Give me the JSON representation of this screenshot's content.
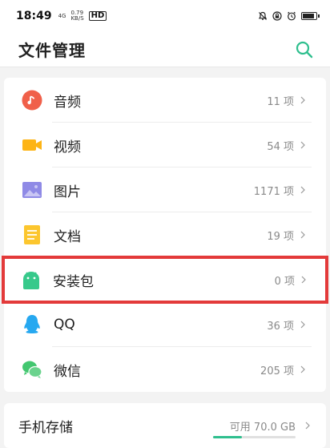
{
  "status_bar": {
    "time": "18:49",
    "signal": "4G",
    "speed_value": "0.79",
    "speed_unit": "KB/S",
    "hd": "HD",
    "battery_level": 0.9
  },
  "header": {
    "title": "文件管理",
    "search_icon": "search-icon",
    "accent": "#2fbf8e"
  },
  "categories": [
    {
      "label": "音频",
      "count": "11 项",
      "icon": "music-icon",
      "color": "#f0604a"
    },
    {
      "label": "视频",
      "count": "54 项",
      "icon": "video-icon",
      "color": "#fdb415"
    },
    {
      "label": "图片",
      "count": "1171 项",
      "icon": "image-icon",
      "color": "#8f8ae6"
    },
    {
      "label": "文档",
      "count": "19 项",
      "icon": "document-icon",
      "color": "#fcc62e"
    },
    {
      "label": "安装包",
      "count": "0 项",
      "icon": "android-icon",
      "color": "#37c98b"
    },
    {
      "label": "QQ",
      "count": "36 项",
      "icon": "qq-icon",
      "color": "#26a8f0"
    },
    {
      "label": "微信",
      "count": "205 项",
      "icon": "wechat-icon",
      "color": "#43c770"
    }
  ],
  "storage": {
    "label": "手机存储",
    "available": "可用 70.0 GB",
    "used_fraction": 0.35
  },
  "highlight_color": "#e33a3a"
}
